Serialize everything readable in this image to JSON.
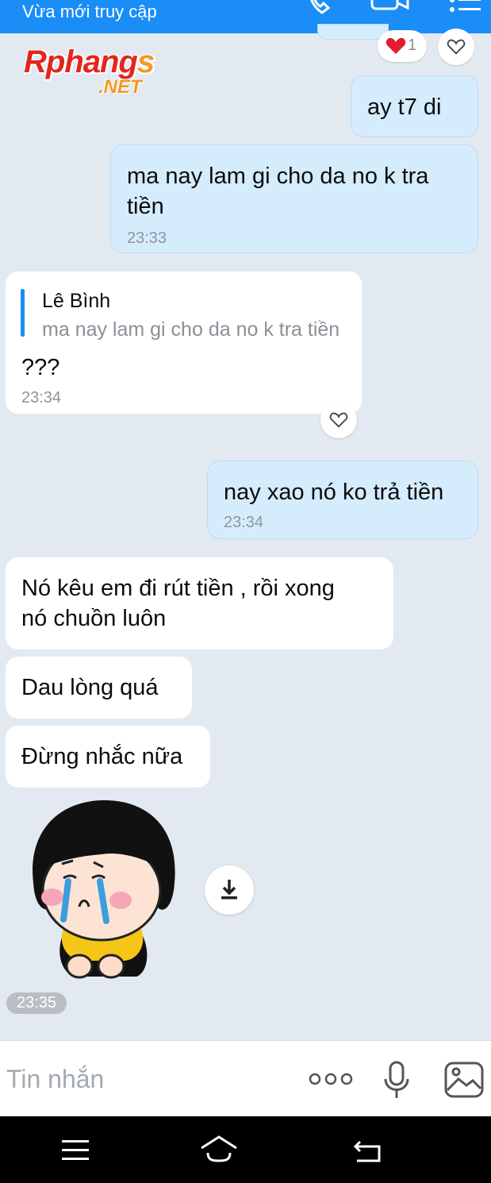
{
  "header": {
    "status": "Vừa mới truy cập",
    "icons": [
      "phone-icon",
      "video-call-icon",
      "menu-icon"
    ]
  },
  "watermark": {
    "brand": "Rphang",
    "brand_s": "s",
    "net": ".NET"
  },
  "reactions": {
    "top": {
      "emoji": "heart",
      "count": "1"
    }
  },
  "messages": [
    {
      "side": "me",
      "text": "ay t7 di"
    },
    {
      "side": "me",
      "text_l1": "ma nay lam gi cho da no k tra",
      "text_l2": "tiền",
      "time": "23:33"
    },
    {
      "side": "them",
      "quote_author": "Lê Bình",
      "quote_text": "ma nay lam gi cho da no k tra tiền",
      "text": "???",
      "time": "23:34"
    },
    {
      "side": "me",
      "text": "nay xao nó ko trả tiền",
      "time": "23:34"
    },
    {
      "side": "them",
      "text_l1": "Nó kêu  em đi rút tiền , rồi xong",
      "text_l2": "nó chuồn luôn"
    },
    {
      "side": "them",
      "text": "Dau lòng quá"
    },
    {
      "side": "them",
      "text": "Đừng nhắc nữa"
    },
    {
      "side": "them",
      "type": "sticker",
      "time": "23:35"
    }
  ],
  "input": {
    "placeholder": "Tin nhắn",
    "icons": [
      "more-icon",
      "microphone-icon",
      "image-icon"
    ]
  },
  "navbar": {
    "icons": [
      "nav-menu-icon",
      "nav-home-icon",
      "nav-back-icon"
    ]
  },
  "colors": {
    "header": "#1a8df7",
    "background": "#e2e9f1",
    "my_bubble": "#d5ecfd",
    "their_bubble": "#ffffff"
  }
}
